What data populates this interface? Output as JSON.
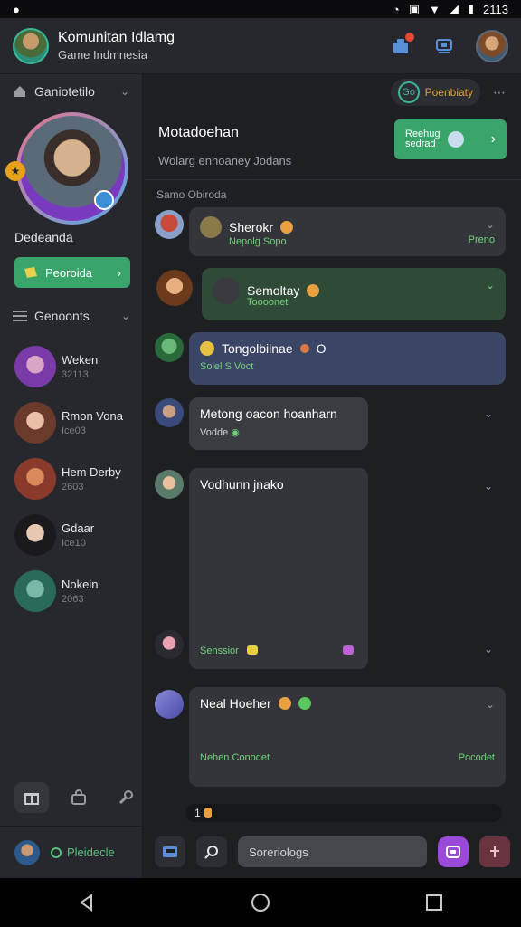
{
  "status_bar": {
    "time": "2113"
  },
  "header": {
    "title": "Komunitan Idlamg",
    "subtitle": "Game Indmnesia"
  },
  "sidebar": {
    "server_label": "Ganiotetilo",
    "profile_name": "Dedeanda",
    "action_label": "Peoroida",
    "section_label": "Genoonts",
    "contacts": [
      {
        "name": "Weken",
        "meta": "32113"
      },
      {
        "name": "Rmon Vona",
        "meta": "Ice03"
      },
      {
        "name": "Hem Derby",
        "meta": "2603"
      },
      {
        "name": "Gdaar",
        "meta": "Ice10"
      },
      {
        "name": "Nokein",
        "meta": "2063"
      }
    ],
    "footer_label": "Pleidecle"
  },
  "main": {
    "top_pill_label": "Poenbiaty",
    "top_pill_icon_text": "Go",
    "conversation_title": "Motadoehan",
    "conversation_subtitle": "Wolarg enhoaney Jodans",
    "cta_label": "Reehug\nsedrad",
    "section_label": "Samo Obiroda",
    "messages": [
      {
        "title": "Sherokr",
        "sub": "Nepolg Sopo",
        "right": "Preno"
      },
      {
        "title": "Semoltay",
        "sub": "Toooonet",
        "right": ""
      },
      {
        "title": "Tongolbilnae",
        "title_suffix": "O",
        "sub": "Solel S Voct",
        "right": ""
      },
      {
        "title": "Metong oacon hoanharn",
        "sub": "Vodde",
        "right": ""
      },
      {
        "title": "Vodhunn jnako",
        "sub": "Senssior",
        "right": ""
      },
      {
        "title": "Neal Hoeher",
        "sub": "Nehen Conodet",
        "right": "Pocodet"
      }
    ],
    "composer_placeholder": "Soreriologs",
    "strip_text": "1"
  },
  "colors": {
    "accent_green": "#3aa56a",
    "text_green": "#6fd37a",
    "bubble_dark": "#33353a",
    "bubble_green": "#2f4a37",
    "bubble_blue": "#3b4566",
    "purple": "#9b49d8"
  },
  "icons": {
    "notifications": "bell-icon",
    "cast": "screen-icon",
    "gift": "gift-icon",
    "store": "bag-icon",
    "settings": "wrench-icon",
    "search": "search-icon",
    "image": "image-icon",
    "camera": "camera-icon",
    "send": "plus-icon"
  }
}
